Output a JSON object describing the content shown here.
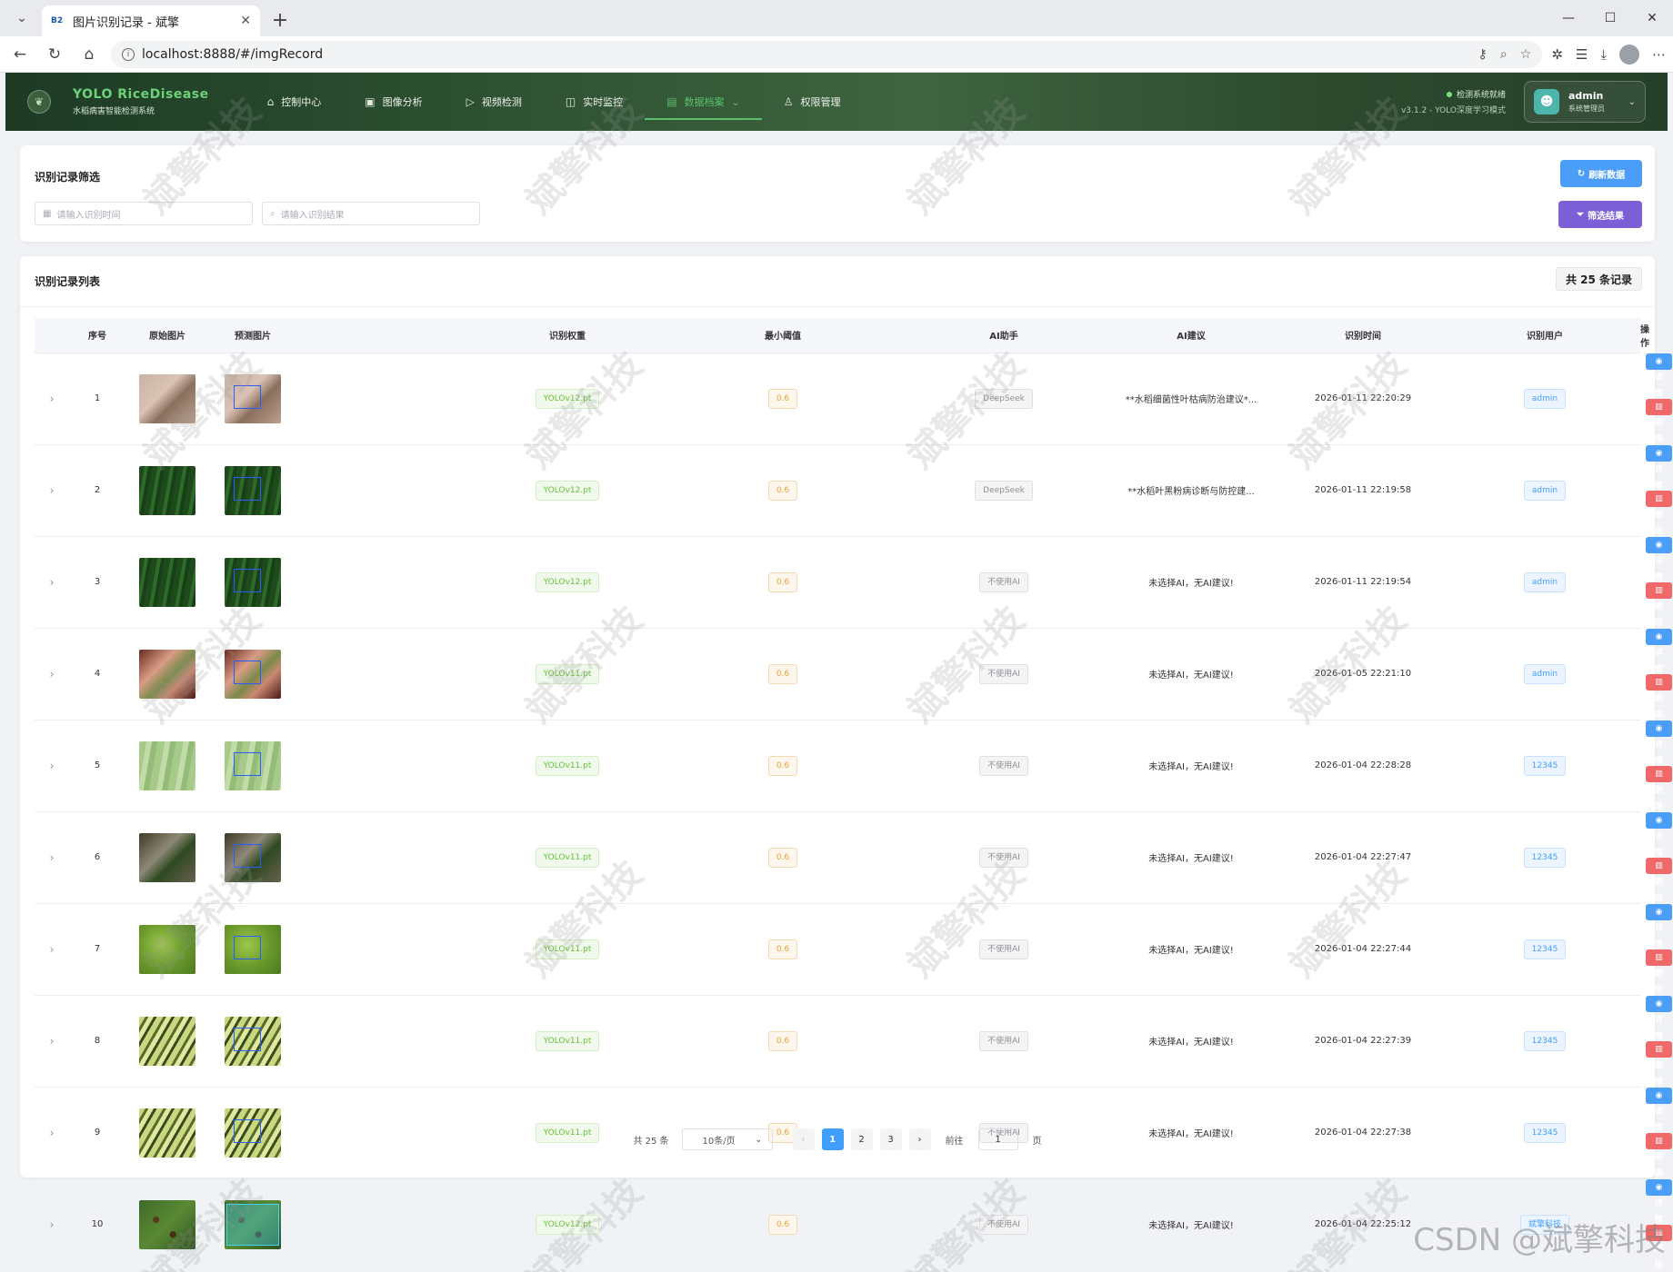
{
  "browser": {
    "tab_title": "图片识别记录 - 斌擎",
    "favicon_text": "B2",
    "url": "localhost:8888/#/imgRecord"
  },
  "header": {
    "brand_title": "YOLO RiceDisease",
    "brand_subtitle": "水稻病害智能检测系统",
    "nav": [
      {
        "label": "控制中心",
        "icon": "home-icon",
        "glyph": "⌂"
      },
      {
        "label": "图像分析",
        "icon": "image-icon",
        "glyph": "▣"
      },
      {
        "label": "视频检测",
        "icon": "play-icon",
        "glyph": "▷"
      },
      {
        "label": "实时监控",
        "icon": "camera-icon",
        "glyph": "◫"
      },
      {
        "label": "数据档案",
        "icon": "document-icon",
        "glyph": "▤",
        "chevron": "⌄"
      },
      {
        "label": "权限管理",
        "icon": "user-icon",
        "glyph": "♙"
      }
    ],
    "status_text": "检测系统就绪",
    "version_text": "v3.1.2 - YOLO深度学习模式",
    "user_name": "admin",
    "user_role": "系统管理员"
  },
  "filter": {
    "title": "识别记录筛选",
    "time_placeholder": "请输入识别时间",
    "result_placeholder": "请输入识别结果",
    "refresh_label": "刷新数据",
    "filter_label": "筛选结果"
  },
  "list": {
    "title": "识别记录列表",
    "total_badge": "共 25 条记录",
    "columns": [
      "序号",
      "原始图片",
      "预测图片",
      "识别权重",
      "最小阈值",
      "AI助手",
      "AI建议",
      "识别时间",
      "识别用户",
      "操作"
    ],
    "detail_label": "详情",
    "delete_label": "删除",
    "rows": [
      {
        "idx": "1",
        "weight": "YOLOv12.pt",
        "threshold": "0.6",
        "ai": "DeepSeek",
        "advice": "**水稻细菌性叶枯病防治建议*...",
        "time": "2026-01-11 22:20:29",
        "user": "admin",
        "img": "ground"
      },
      {
        "idx": "2",
        "weight": "YOLOv12.pt",
        "threshold": "0.6",
        "ai": "DeepSeek",
        "advice": "**水稻叶黑粉病诊断与防控建...",
        "time": "2026-01-11 22:19:58",
        "user": "admin",
        "img": "darkleaf"
      },
      {
        "idx": "3",
        "weight": "YOLOv12.pt",
        "threshold": "0.6",
        "ai": "不使用AI",
        "advice": "未选择AI，无AI建议!",
        "time": "2026-01-11 22:19:54",
        "user": "admin",
        "img": "darkleaf"
      },
      {
        "idx": "4",
        "weight": "YOLOv11.pt",
        "threshold": "0.6",
        "ai": "不使用AI",
        "advice": "未选择AI，无AI建议!",
        "time": "2026-01-05 22:21:10",
        "user": "admin",
        "img": "hand"
      },
      {
        "idx": "5",
        "weight": "YOLOv11.pt",
        "threshold": "0.6",
        "ai": "不使用AI",
        "advice": "未选择AI，无AI建议!",
        "time": "2026-01-04 22:28:28",
        "user": "12345",
        "img": "paleleaf"
      },
      {
        "idx": "6",
        "weight": "YOLOv11.pt",
        "threshold": "0.6",
        "ai": "不使用AI",
        "advice": "未选择AI，无AI建议!",
        "time": "2026-01-04 22:27:47",
        "user": "12345",
        "img": "stem"
      },
      {
        "idx": "7",
        "weight": "YOLOv11.pt",
        "threshold": "0.6",
        "ai": "不使用AI",
        "advice": "未选择AI，无AI建议!",
        "time": "2026-01-04 22:27:44",
        "user": "12345",
        "img": "field"
      },
      {
        "idx": "8",
        "weight": "YOLOv11.pt",
        "threshold": "0.6",
        "ai": "不使用AI",
        "advice": "未选择AI，无AI建议!",
        "time": "2026-01-04 22:27:39",
        "user": "12345",
        "img": "yellow"
      },
      {
        "idx": "9",
        "weight": "YOLOv11.pt",
        "threshold": "0.6",
        "ai": "不使用AI",
        "advice": "未选择AI，无AI建议!",
        "time": "2026-01-04 22:27:38",
        "user": "12345",
        "img": "yellow"
      },
      {
        "idx": "10",
        "weight": "YOLOv12.pt",
        "threshold": "0.6",
        "ai": "不使用AI",
        "advice": "未选择AI，无AI建议!",
        "time": "2026-01-04 22:25:12",
        "user": "斌擎科技",
        "img": "spotted"
      }
    ]
  },
  "pagination": {
    "total_text": "共 25 条",
    "page_size": "10条/页",
    "prev": "‹",
    "next": "›",
    "pages": [
      "1",
      "2",
      "3"
    ],
    "current_page": 1,
    "goto_label": "前往",
    "goto_value": "1",
    "page_suffix": "页"
  },
  "watermark": "斌擎科技",
  "footer_watermark": "CSDN @斌擎科技",
  "colors": {
    "primary": "#409eff",
    "success": "#67c23a",
    "warning": "#e6a23c",
    "danger": "#f06868",
    "purple": "#7a5fd6",
    "header_green": "#2e5232",
    "accent_green": "#58c06c"
  }
}
